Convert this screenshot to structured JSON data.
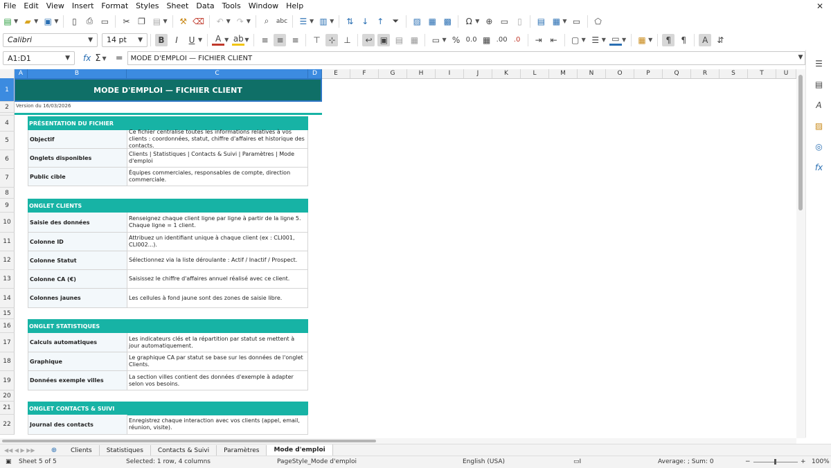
{
  "menu": [
    "File",
    "Edit",
    "View",
    "Insert",
    "Format",
    "Styles",
    "Sheet",
    "Data",
    "Tools",
    "Window",
    "Help"
  ],
  "font": {
    "name": "Calibri",
    "size": "14 pt"
  },
  "formula": {
    "cell_ref": "A1:D1",
    "content": "MODE D'EMPLOI — FICHIER CLIENT"
  },
  "columns": [
    "A",
    "B",
    "C",
    "D",
    "E",
    "F",
    "G",
    "H",
    "I",
    "J",
    "K",
    "L",
    "M",
    "N",
    "O",
    "P",
    "Q",
    "R",
    "S",
    "T",
    "U"
  ],
  "rows": [
    "1",
    "2",
    "4",
    "5",
    "6",
    "7",
    "8",
    "9",
    "10",
    "11",
    "12",
    "13",
    "14",
    "15",
    "16",
    "17",
    "18",
    "19",
    "20",
    "21",
    "22"
  ],
  "sheet": {
    "title": "MODE D'EMPLOI — FICHIER CLIENT",
    "version": "Version du 16/03/2026",
    "sections": [
      {
        "header": "PRÉSENTATION DU FICHIER",
        "rows": [
          {
            "label": "Objectif",
            "value": "Ce fichier centralise toutes les informations relatives à vos clients : coordonnées, statut, chiffre d'affaires et historique des contacts."
          },
          {
            "label": "Onglets disponibles",
            "value": "Clients | Statistiques | Contacts & Suivi | Paramètres | Mode d'emploi"
          },
          {
            "label": "Public cible",
            "value": "Équipes commerciales, responsables de compte, direction commerciale."
          }
        ]
      },
      {
        "header": "ONGLET CLIENTS",
        "rows": [
          {
            "label": "Saisie des données",
            "value": "Renseignez chaque client ligne par ligne à partir de la ligne 5. Chaque ligne = 1 client."
          },
          {
            "label": "Colonne ID",
            "value": "Attribuez un identifiant unique à chaque client (ex : CLI001, CLI002...)."
          },
          {
            "label": "Colonne Statut",
            "value": "Sélectionnez via la liste déroulante : Actif / Inactif / Prospect."
          },
          {
            "label": "Colonne CA (€)",
            "value": "Saisissez le chiffre d'affaires annuel réalisé avec ce client."
          },
          {
            "label": "Colonnes jaunes",
            "value": "Les cellules à fond jaune sont des zones de saisie libre."
          }
        ]
      },
      {
        "header": "ONGLET STATISTIQUES",
        "rows": [
          {
            "label": "Calculs automatiques",
            "value": "Les indicateurs clés et la répartition par statut se mettent à jour automatiquement."
          },
          {
            "label": "Graphique",
            "value": "Le graphique CA par statut se base sur les données de l'onglet Clients."
          },
          {
            "label": "Données exemple villes",
            "value": "La section villes contient des données d'exemple à adapter selon vos besoins."
          }
        ]
      },
      {
        "header": "ONGLET CONTACTS & SUIVI",
        "rows": [
          {
            "label": "Journal des contacts",
            "value": "Enregistrez chaque interaction avec vos clients (appel, email, réunion, visite)."
          }
        ]
      }
    ]
  },
  "tabs": [
    "Clients",
    "Statistiques",
    "Contacts & Suivi",
    "Paramètres",
    "Mode d'emploi"
  ],
  "active_tab": "Mode d'emploi",
  "status": {
    "sheet": "Sheet 5 of 5",
    "selection": "Selected: 1 row, 4 columns",
    "page_style": "PageStyle_Mode d'emploi",
    "language": "English (USA)",
    "summary": "Average: ; Sum: 0",
    "zoom": "100%"
  },
  "colors": {
    "title_bg": "#0f6f67",
    "section_bg": "#17b3a5",
    "selection": "#3c8be0"
  }
}
